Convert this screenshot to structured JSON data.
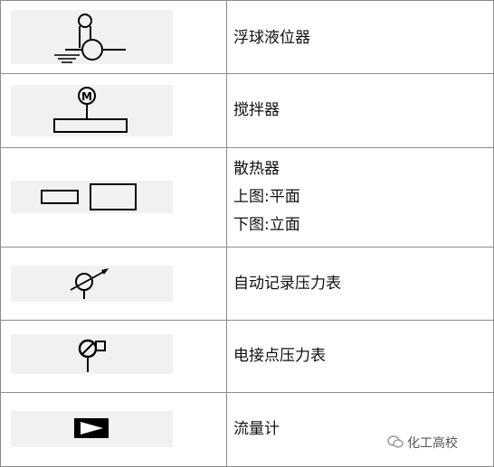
{
  "rows": [
    {
      "label": "浮球液位器",
      "icon": "float-ball-level-icon"
    },
    {
      "label": "搅拌器",
      "icon": "agitator-motor-icon"
    },
    {
      "label_lines": [
        "散热器",
        "上图:平面",
        "下图:立面"
      ],
      "icon": "radiator-icon"
    },
    {
      "label": "自动记录压力表",
      "icon": "recording-pressure-gauge-icon"
    },
    {
      "label": "电接点压力表",
      "icon": "electric-contact-pressure-gauge-icon"
    },
    {
      "label": "流量计",
      "icon": "flowmeter-icon"
    }
  ],
  "agitator_letter": "M",
  "watermark": "化工高校"
}
